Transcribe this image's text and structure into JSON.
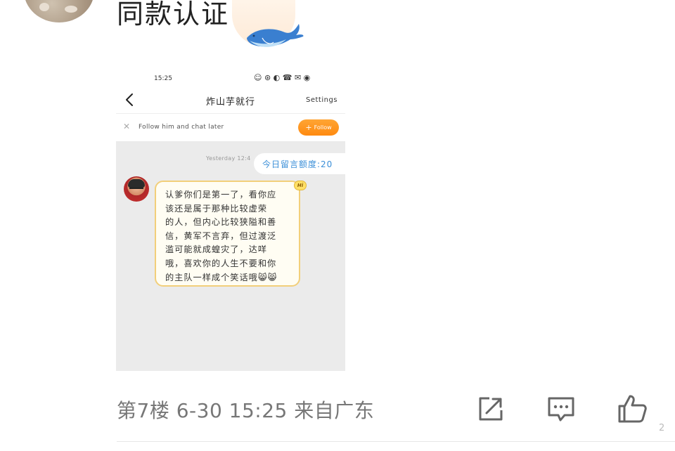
{
  "post": {
    "text": "同款认证",
    "meta": "第7楼 6-30 15:25 来自广东",
    "corner_count": "2"
  },
  "screenshot": {
    "status_time": "15:25",
    "status_icons": "☺ ⊛ ◐ ☎ ✉ ◉",
    "header": {
      "title": "炸山芋就行",
      "settings_label": "Settings"
    },
    "follow_bar": {
      "close_symbol": "✕",
      "text": "Follow him and chat later",
      "button_label": "Follow",
      "button_plus": "+"
    },
    "chat": {
      "timestamp": "Yesterday 12:4",
      "quota": "今日留言额度:20",
      "badge": "Hi",
      "message": "认爹你们是第一了，看你应\n该还是属于那种比较虚荣\n的人，但内心比较狭隘和善\n信，黄军不言弃，但过渡泛\n滥可能就成蝗灾了，达咩\n哦，喜欢你的人生不要和你\n的主队一样成个笑话哦😸😸"
    }
  },
  "actions": {
    "share_icon": "share-icon",
    "comment_icon": "comment-icon",
    "like_icon": "thumbs-up-icon"
  },
  "colors": {
    "follow_button": "#ff8a10",
    "quota_text": "#3b8fd8",
    "bubble_border": "#f2cf7a",
    "chat_bg": "#ebebeb"
  }
}
